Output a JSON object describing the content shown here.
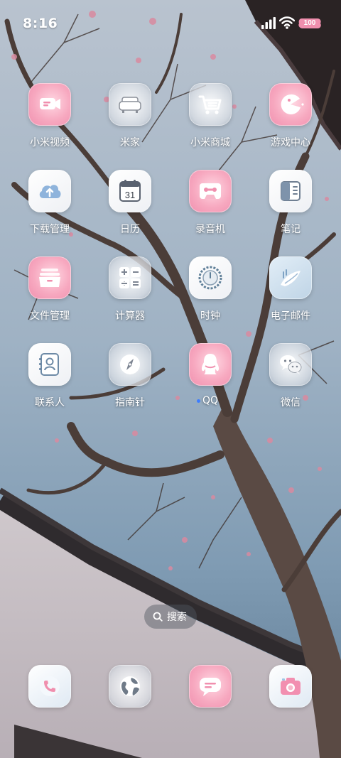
{
  "status_bar": {
    "time": "8:16",
    "battery": "100",
    "icons": [
      "signal-icon",
      "wifi-icon",
      "battery-icon"
    ]
  },
  "apps": [
    {
      "label": "小米视频",
      "icon": "video-icon"
    },
    {
      "label": "米家",
      "icon": "sofa-icon"
    },
    {
      "label": "小米商城",
      "icon": "cart-icon"
    },
    {
      "label": "游戏中心",
      "icon": "game-icon"
    },
    {
      "label": "下载管理",
      "icon": "download-cloud-icon"
    },
    {
      "label": "日历",
      "icon": "calendar-icon",
      "date": "31"
    },
    {
      "label": "录音机",
      "icon": "cassette-icon"
    },
    {
      "label": "笔记",
      "icon": "notes-icon"
    },
    {
      "label": "文件管理",
      "icon": "folder-icon"
    },
    {
      "label": "计算器",
      "icon": "calculator-icon"
    },
    {
      "label": "时钟",
      "icon": "clock-icon"
    },
    {
      "label": "电子邮件",
      "icon": "mail-icon"
    },
    {
      "label": "联系人",
      "icon": "contacts-icon"
    },
    {
      "label": "指南针",
      "icon": "compass-icon"
    },
    {
      "label": "QQ",
      "icon": "qq-icon"
    },
    {
      "label": "微信",
      "icon": "wechat-icon"
    }
  ],
  "search": {
    "label": "搜索"
  },
  "dock": [
    {
      "icon": "phone-icon"
    },
    {
      "icon": "browser-globe-icon"
    },
    {
      "icon": "messages-icon"
    },
    {
      "icon": "camera-icon"
    }
  ],
  "colors": {
    "accent_pink": "#f08fae",
    "new_dot": "#3d7dff"
  }
}
